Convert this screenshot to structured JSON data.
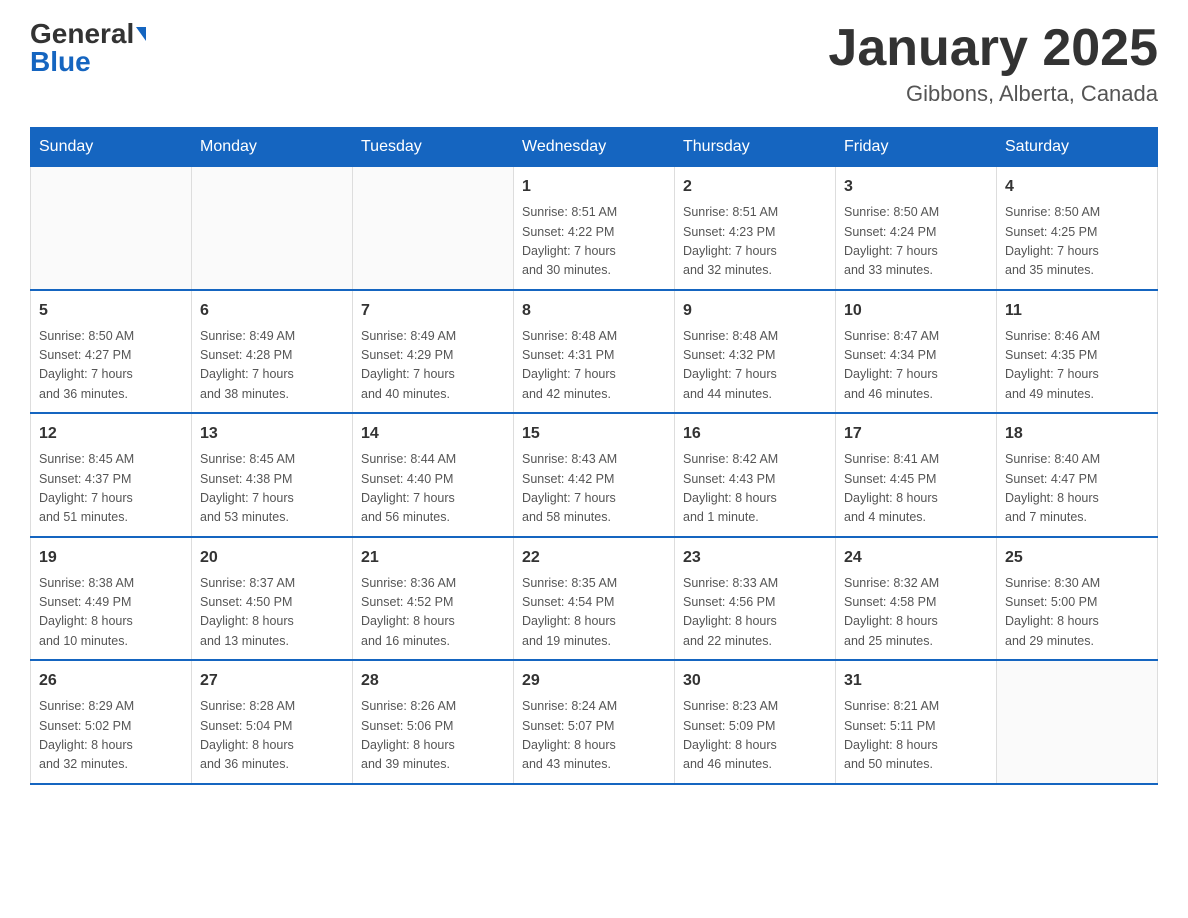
{
  "header": {
    "logo_general": "General",
    "logo_blue": "Blue",
    "title": "January 2025",
    "location": "Gibbons, Alberta, Canada"
  },
  "days_of_week": [
    "Sunday",
    "Monday",
    "Tuesday",
    "Wednesday",
    "Thursday",
    "Friday",
    "Saturday"
  ],
  "weeks": [
    [
      {
        "day": "",
        "info": ""
      },
      {
        "day": "",
        "info": ""
      },
      {
        "day": "",
        "info": ""
      },
      {
        "day": "1",
        "info": "Sunrise: 8:51 AM\nSunset: 4:22 PM\nDaylight: 7 hours\nand 30 minutes."
      },
      {
        "day": "2",
        "info": "Sunrise: 8:51 AM\nSunset: 4:23 PM\nDaylight: 7 hours\nand 32 minutes."
      },
      {
        "day": "3",
        "info": "Sunrise: 8:50 AM\nSunset: 4:24 PM\nDaylight: 7 hours\nand 33 minutes."
      },
      {
        "day": "4",
        "info": "Sunrise: 8:50 AM\nSunset: 4:25 PM\nDaylight: 7 hours\nand 35 minutes."
      }
    ],
    [
      {
        "day": "5",
        "info": "Sunrise: 8:50 AM\nSunset: 4:27 PM\nDaylight: 7 hours\nand 36 minutes."
      },
      {
        "day": "6",
        "info": "Sunrise: 8:49 AM\nSunset: 4:28 PM\nDaylight: 7 hours\nand 38 minutes."
      },
      {
        "day": "7",
        "info": "Sunrise: 8:49 AM\nSunset: 4:29 PM\nDaylight: 7 hours\nand 40 minutes."
      },
      {
        "day": "8",
        "info": "Sunrise: 8:48 AM\nSunset: 4:31 PM\nDaylight: 7 hours\nand 42 minutes."
      },
      {
        "day": "9",
        "info": "Sunrise: 8:48 AM\nSunset: 4:32 PM\nDaylight: 7 hours\nand 44 minutes."
      },
      {
        "day": "10",
        "info": "Sunrise: 8:47 AM\nSunset: 4:34 PM\nDaylight: 7 hours\nand 46 minutes."
      },
      {
        "day": "11",
        "info": "Sunrise: 8:46 AM\nSunset: 4:35 PM\nDaylight: 7 hours\nand 49 minutes."
      }
    ],
    [
      {
        "day": "12",
        "info": "Sunrise: 8:45 AM\nSunset: 4:37 PM\nDaylight: 7 hours\nand 51 minutes."
      },
      {
        "day": "13",
        "info": "Sunrise: 8:45 AM\nSunset: 4:38 PM\nDaylight: 7 hours\nand 53 minutes."
      },
      {
        "day": "14",
        "info": "Sunrise: 8:44 AM\nSunset: 4:40 PM\nDaylight: 7 hours\nand 56 minutes."
      },
      {
        "day": "15",
        "info": "Sunrise: 8:43 AM\nSunset: 4:42 PM\nDaylight: 7 hours\nand 58 minutes."
      },
      {
        "day": "16",
        "info": "Sunrise: 8:42 AM\nSunset: 4:43 PM\nDaylight: 8 hours\nand 1 minute."
      },
      {
        "day": "17",
        "info": "Sunrise: 8:41 AM\nSunset: 4:45 PM\nDaylight: 8 hours\nand 4 minutes."
      },
      {
        "day": "18",
        "info": "Sunrise: 8:40 AM\nSunset: 4:47 PM\nDaylight: 8 hours\nand 7 minutes."
      }
    ],
    [
      {
        "day": "19",
        "info": "Sunrise: 8:38 AM\nSunset: 4:49 PM\nDaylight: 8 hours\nand 10 minutes."
      },
      {
        "day": "20",
        "info": "Sunrise: 8:37 AM\nSunset: 4:50 PM\nDaylight: 8 hours\nand 13 minutes."
      },
      {
        "day": "21",
        "info": "Sunrise: 8:36 AM\nSunset: 4:52 PM\nDaylight: 8 hours\nand 16 minutes."
      },
      {
        "day": "22",
        "info": "Sunrise: 8:35 AM\nSunset: 4:54 PM\nDaylight: 8 hours\nand 19 minutes."
      },
      {
        "day": "23",
        "info": "Sunrise: 8:33 AM\nSunset: 4:56 PM\nDaylight: 8 hours\nand 22 minutes."
      },
      {
        "day": "24",
        "info": "Sunrise: 8:32 AM\nSunset: 4:58 PM\nDaylight: 8 hours\nand 25 minutes."
      },
      {
        "day": "25",
        "info": "Sunrise: 8:30 AM\nSunset: 5:00 PM\nDaylight: 8 hours\nand 29 minutes."
      }
    ],
    [
      {
        "day": "26",
        "info": "Sunrise: 8:29 AM\nSunset: 5:02 PM\nDaylight: 8 hours\nand 32 minutes."
      },
      {
        "day": "27",
        "info": "Sunrise: 8:28 AM\nSunset: 5:04 PM\nDaylight: 8 hours\nand 36 minutes."
      },
      {
        "day": "28",
        "info": "Sunrise: 8:26 AM\nSunset: 5:06 PM\nDaylight: 8 hours\nand 39 minutes."
      },
      {
        "day": "29",
        "info": "Sunrise: 8:24 AM\nSunset: 5:07 PM\nDaylight: 8 hours\nand 43 minutes."
      },
      {
        "day": "30",
        "info": "Sunrise: 8:23 AM\nSunset: 5:09 PM\nDaylight: 8 hours\nand 46 minutes."
      },
      {
        "day": "31",
        "info": "Sunrise: 8:21 AM\nSunset: 5:11 PM\nDaylight: 8 hours\nand 50 minutes."
      },
      {
        "day": "",
        "info": ""
      }
    ]
  ]
}
